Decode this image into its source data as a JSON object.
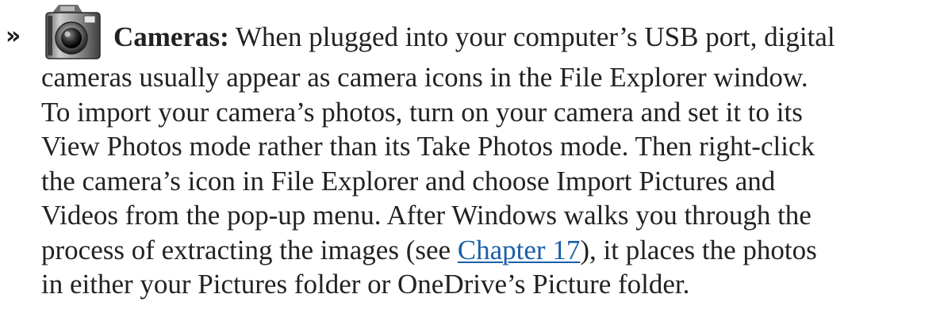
{
  "bullet": {
    "marker": "»",
    "icon": "camera-icon",
    "term": "Cameras:",
    "first_line": " When plugged into your computer’s USB port, digital",
    "lines": [
      "cameras usually appear as camera icons in the File Explorer window.",
      "To import your camera’s photos, turn on your camera and set it to its",
      "View Photos mode rather than its Take Photos mode. Then right-click",
      "the camera’s icon in File Explorer and choose Import Pictures and",
      "Videos from the pop-up menu. After Windows walks you through the"
    ],
    "link_line_before": "process of extracting the images (see ",
    "link_text": "Chapter 17",
    "link_line_after": "), it places the photos",
    "last_line": "in either your Pictures folder or OneDrive’s Picture folder."
  },
  "colors": {
    "text": "#222222",
    "link": "#1a5fa8"
  }
}
